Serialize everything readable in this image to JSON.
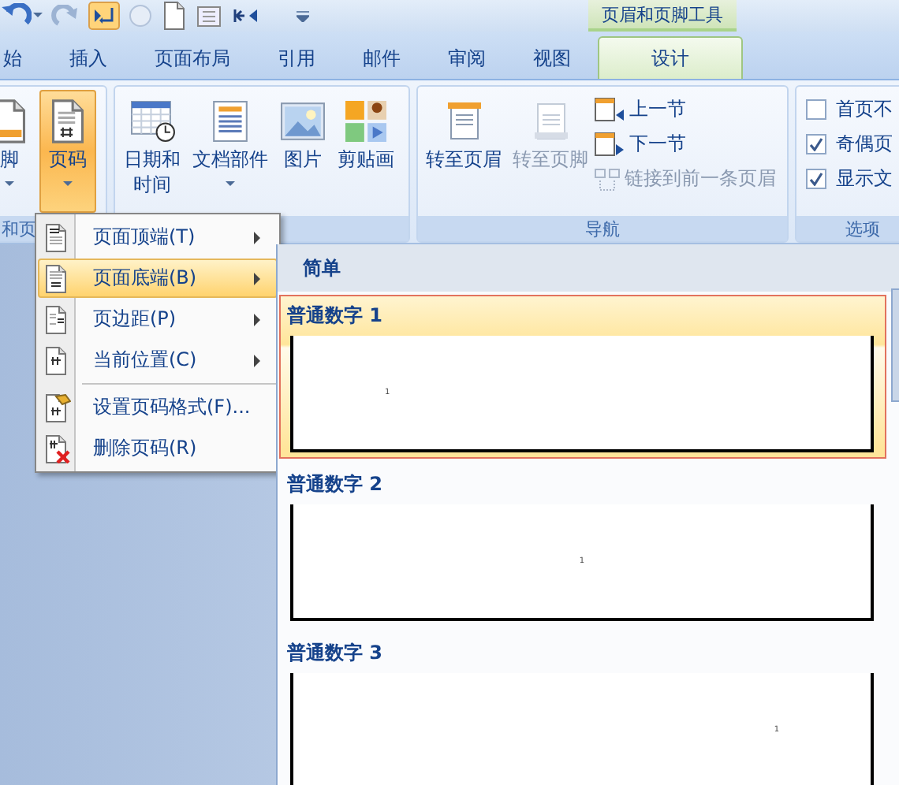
{
  "contextual_group": {
    "label": "页眉和页脚工具"
  },
  "tabs": [
    {
      "label": "始",
      "selected": false
    },
    {
      "label": "插入",
      "selected": false
    },
    {
      "label": "页面布局",
      "selected": false
    },
    {
      "label": "引用",
      "selected": false
    },
    {
      "label": "邮件",
      "selected": false
    },
    {
      "label": "审阅",
      "selected": false
    },
    {
      "label": "视图",
      "selected": false
    },
    {
      "label": "设计",
      "selected": true
    }
  ],
  "ribbon": {
    "groups": [
      {
        "kind": "buttons",
        "label": "和页",
        "buttons": [
          {
            "kind": "footer",
            "label": "脚",
            "selected": false,
            "dropdown": true
          },
          {
            "kind": "pagenum",
            "label": "页码",
            "selected": true,
            "dropdown": true
          }
        ]
      },
      {
        "kind": "buttons",
        "buttons": [
          {
            "kind": "date",
            "label": "日期和时间",
            "selected": false,
            "dropdown": false
          },
          {
            "kind": "parts",
            "label": "文档部件",
            "selected": false,
            "dropdown": true
          },
          {
            "kind": "picture",
            "label": "图片",
            "selected": false,
            "dropdown": false
          },
          {
            "kind": "clipart",
            "label": "剪贴画",
            "selected": false,
            "dropdown": false
          }
        ]
      },
      {
        "kind": "navigation",
        "label": "导航",
        "large": [
          {
            "label": "转至页眉",
            "disabled": false
          },
          {
            "label": "转至页脚",
            "disabled": true
          }
        ],
        "small": [
          {
            "kind": "prev",
            "label": "上一节",
            "disabled": false
          },
          {
            "kind": "next",
            "label": "下一节",
            "disabled": false
          },
          {
            "kind": "link",
            "label": "链接到前一条页眉",
            "disabled": true
          }
        ]
      },
      {
        "kind": "options",
        "label": "选项",
        "checkboxes": [
          {
            "label": "首页不",
            "checked": false
          },
          {
            "label": "奇偶页",
            "checked": true
          },
          {
            "label": "显示文",
            "checked": true
          }
        ]
      }
    ]
  },
  "page_number_menu": [
    {
      "kind": "top",
      "label": "页面顶端(T)",
      "submenu": true,
      "selected": false
    },
    {
      "kind": "bottom",
      "label": "页面底端(B)",
      "submenu": true,
      "selected": true
    },
    {
      "kind": "margin",
      "label": "页边距(P)",
      "submenu": true,
      "selected": false
    },
    {
      "kind": "current",
      "label": "当前位置(C)",
      "submenu": true,
      "selected": false
    },
    {
      "kind": "format",
      "label": "设置页码格式(F)...",
      "submenu": false,
      "selected": false
    },
    {
      "kind": "delete",
      "label": "删除页码(R)",
      "submenu": false,
      "selected": false
    }
  ],
  "gallery": {
    "section": "简单",
    "items": [
      {
        "label": "普通数字 1",
        "kind": "left",
        "number": "1",
        "selected": true
      },
      {
        "label": "普通数字 2",
        "kind": "center",
        "number": "1",
        "selected": false
      },
      {
        "label": "普通数字 3",
        "kind": "right",
        "number": "1",
        "selected": false
      }
    ]
  }
}
